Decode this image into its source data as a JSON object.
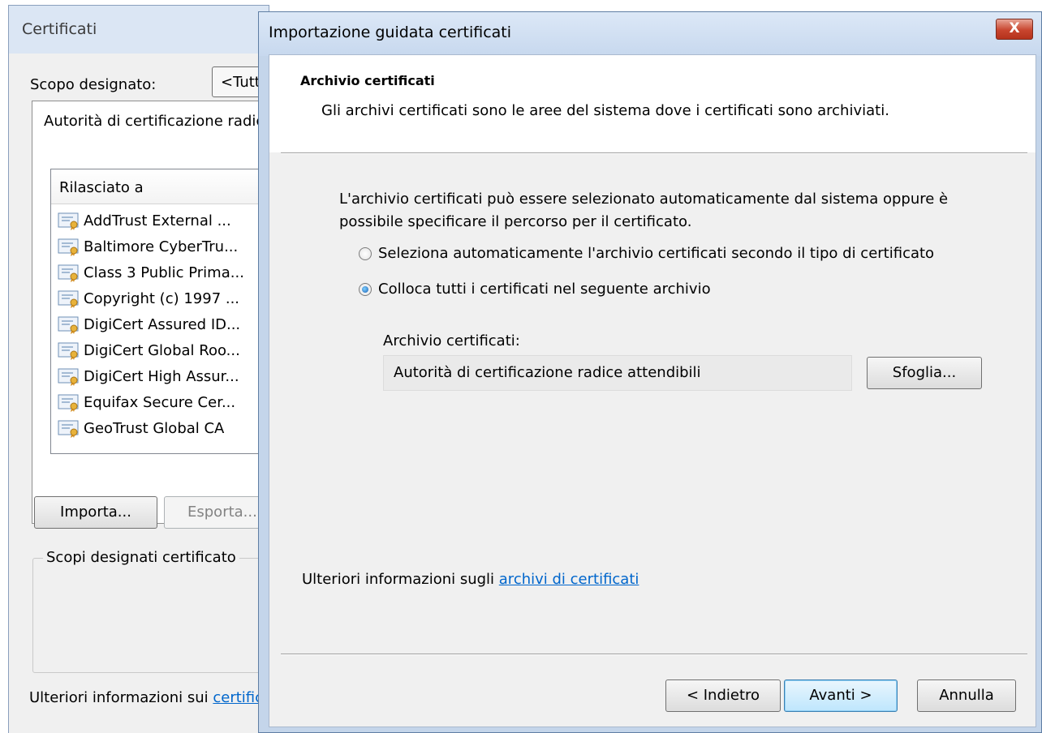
{
  "background_window": {
    "title": "Certificati",
    "scope_label": "Scopo designato:",
    "scope_value": "<Tutti>",
    "tab_label": "Autorità di certificazione radice attendibili",
    "list_header": "Rilasciato a",
    "certificates": [
      "AddTrust External ...",
      "Baltimore CyberTru...",
      "Class 3 Public Prima...",
      "Copyright (c) 1997 ...",
      "DigiCert Assured ID...",
      "DigiCert Global Roo...",
      "DigiCert High Assur...",
      "Equifax Secure Cer...",
      "GeoTrust Global CA"
    ],
    "import_button": "Importa...",
    "export_button": "Esporta...",
    "purposes_group_label": "Scopi designati certificato",
    "more_info_prefix": "Ulteriori informazioni sui ",
    "more_info_link": "certificati"
  },
  "dialog": {
    "title": "Importazione guidata certificati",
    "close_label": "X",
    "section_title": "Archivio certificati",
    "section_description": "Gli archivi certificati sono le aree del sistema dove i certificati sono archiviati.",
    "intro_text": "L'archivio certificati può essere selezionato automaticamente dal sistema oppure è possibile specificare il percorso per il certificato.",
    "radio_auto": {
      "label": "Seleziona automaticamente l'archivio certificati secondo il tipo di certificato",
      "checked": false
    },
    "radio_manual": {
      "label": "Colloca tutti i certificati nel seguente archivio",
      "checked": true
    },
    "store_label": "Archivio certificati:",
    "store_value": "Autorità di certificazione radice attendibili",
    "browse_button": "Sfoglia...",
    "more_info_prefix": "Ulteriori informazioni sugli ",
    "more_info_link": "archivi di certificati",
    "back_button": "< Indietro",
    "next_button": "Avanti >",
    "cancel_button": "Annulla"
  },
  "colors": {
    "link": "#0066cc",
    "dialog_frame": "#c4d5ea",
    "close_button": "#c8452e",
    "default_button_border": "#3c7fb1"
  },
  "icons": {
    "certificate": "certificate-icon",
    "close": "close-icon"
  }
}
